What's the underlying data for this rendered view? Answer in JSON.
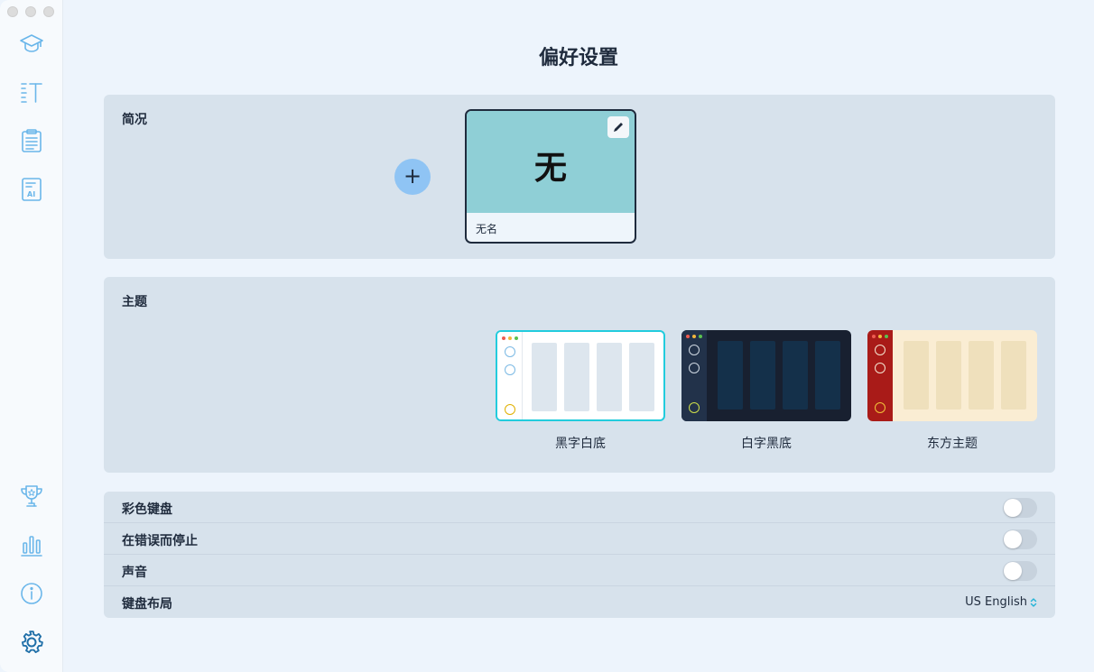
{
  "window": {
    "title": "偏好设置"
  },
  "sidebar": {
    "items": [
      {
        "icon": "graduation-cap-icon"
      },
      {
        "icon": "text-list-icon"
      },
      {
        "icon": "clipboard-icon"
      },
      {
        "icon": "ai-document-icon",
        "text": "AI"
      },
      {
        "icon": "trophy-icon"
      },
      {
        "icon": "bar-chart-icon"
      },
      {
        "icon": "info-icon"
      },
      {
        "icon": "gear-icon",
        "active": true
      }
    ]
  },
  "profile": {
    "label": "简况",
    "add_symbol": "+",
    "card": {
      "glyph": "无",
      "name": "无名",
      "color": "#8fcfd6"
    }
  },
  "theme": {
    "label": "主题",
    "options": [
      {
        "name": "黑字白底",
        "selected": true,
        "bg": "#ffffff",
        "bar": "#ffffff",
        "col": "#dde6ee",
        "border": "#22ccdd"
      },
      {
        "name": "白字黑底",
        "selected": false,
        "bg": "#182030",
        "bar": "#22324a",
        "col": "#14304a",
        "border": "#182030"
      },
      {
        "name": "东方主题",
        "selected": false,
        "bg": "#faedd3",
        "bar": "#a91b18",
        "col": "#efe0bc",
        "border": "#faedd3"
      }
    ]
  },
  "settings": {
    "colored_keyboard": {
      "label": "彩色键盘",
      "on": false
    },
    "stop_on_error": {
      "label": "在错误而停止",
      "on": false
    },
    "sound": {
      "label": "声音",
      "on": false
    },
    "keyboard_layout": {
      "label": "键盘布局",
      "value": "US English",
      "accent": "#22b3d6"
    }
  }
}
